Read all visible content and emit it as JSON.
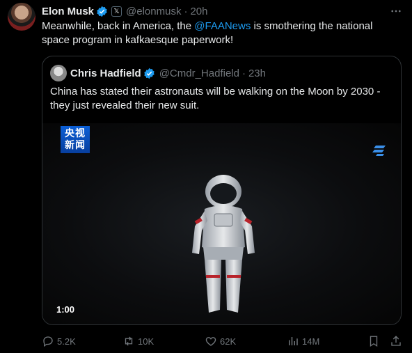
{
  "tweet": {
    "author_name": "Elon Musk",
    "author_handle": "@elonmusk",
    "time": "20h",
    "text_before": "Meanwhile, back in America, the ",
    "mention": "@FAANews",
    "text_after": " is smothering the national space program in kafkaesque paperwork!"
  },
  "quote": {
    "author_name": "Chris Hadfield",
    "author_handle": "@Cmdr_Hadfield",
    "time": "23h",
    "text": "China has stated their astronauts will be walking on the Moon by 2030 - they just revealed their new suit.",
    "media": {
      "logo_line1": "央视",
      "logo_line2": "新闻",
      "duration": "1:00"
    }
  },
  "actions": {
    "replies": "5.2K",
    "reposts": "10K",
    "likes": "62K",
    "views": "14M"
  },
  "colors": {
    "accent": "#1d9bf0",
    "muted": "#71767b",
    "border": "#2f3336"
  }
}
